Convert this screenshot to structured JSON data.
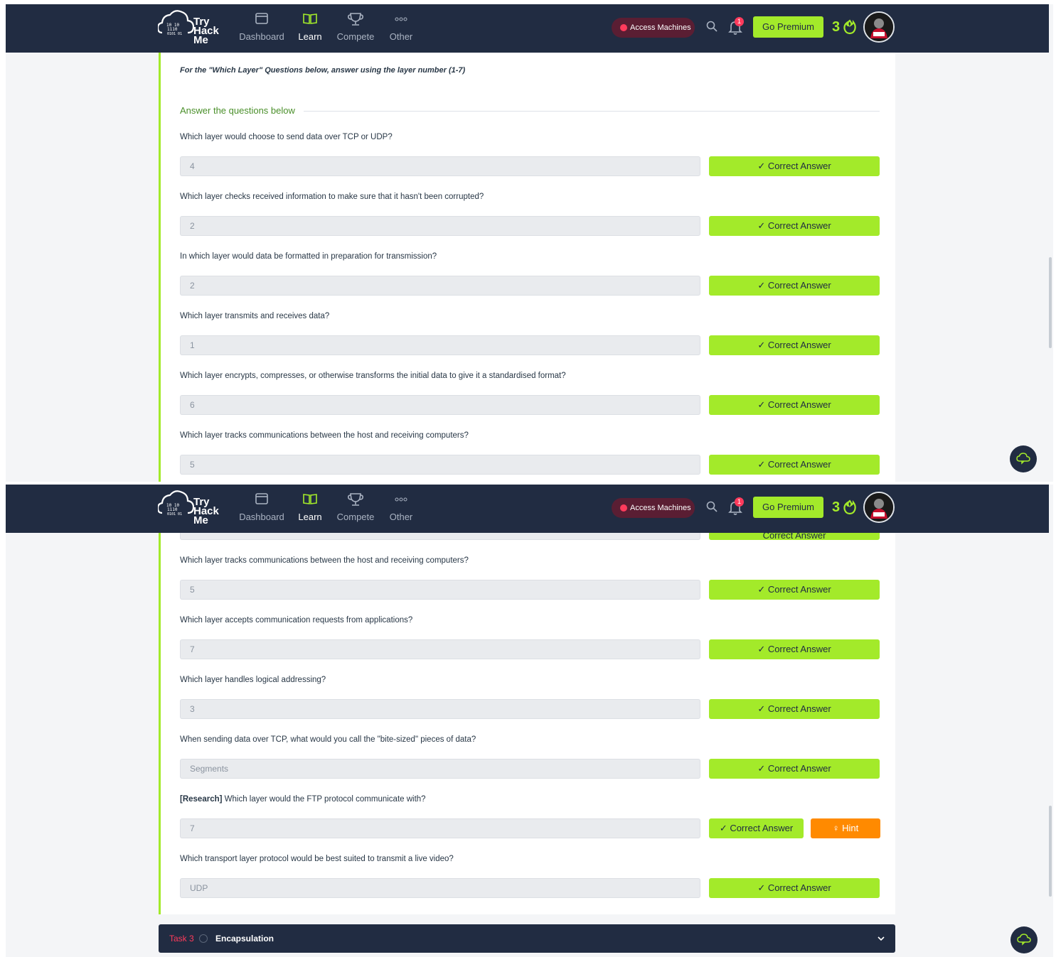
{
  "brand": {
    "line1": "Try",
    "line2": "Hack",
    "line3": "Me"
  },
  "nav": {
    "items": [
      {
        "label": "Dashboard",
        "icon": "window-icon"
      },
      {
        "label": "Learn",
        "icon": "book-icon",
        "active": true
      },
      {
        "label": "Compete",
        "icon": "trophy-icon"
      },
      {
        "label": "Other",
        "icon": "dots-icon"
      }
    ],
    "access_machines": "Access Machines",
    "notification_count": "1",
    "premium": "Go Premium",
    "streak": "3"
  },
  "colors": {
    "navy": "#212c42",
    "lime": "#a3ea2a",
    "orange": "#ff8a00",
    "red": "#ff3b5c"
  },
  "screenshot1": {
    "instruction": "For the \"Which Layer\" Questions below, answer using the layer number (1-7)",
    "section_heading": "Answer the questions below",
    "questions": [
      {
        "text": "Which layer would choose to send data over TCP or UDP?",
        "answer": "4",
        "button": "✓ Correct Answer"
      },
      {
        "text": "Which layer checks received information to make sure that it hasn't been corrupted?",
        "answer": "2",
        "button": "✓ Correct Answer"
      },
      {
        "text": "In which layer would data be formatted in preparation for transmission?",
        "answer": "2",
        "button": "✓ Correct Answer"
      },
      {
        "text": "Which layer transmits and receives data?",
        "answer": "1",
        "button": "✓ Correct Answer"
      },
      {
        "text": "Which layer encrypts, compresses, or otherwise transforms the initial data to give it a standardised format?",
        "answer": "6",
        "button": "✓ Correct Answer"
      },
      {
        "text": "Which layer tracks communications between the host and receiving computers?",
        "answer": "5",
        "button": "✓ Correct Answer"
      }
    ]
  },
  "screenshot2": {
    "partial_button": "Correct Answer",
    "questions": [
      {
        "text": "Which layer tracks communications between the host and receiving computers?",
        "answer": "5",
        "button": "✓ Correct Answer"
      },
      {
        "text": "Which layer accepts communication requests from applications?",
        "answer": "7",
        "button": "✓ Correct Answer"
      },
      {
        "text": "Which layer handles logical addressing?",
        "answer": "3",
        "button": "✓ Correct Answer"
      },
      {
        "text": "When sending data over TCP, what would you call the \"bite-sized\" pieces of data?",
        "answer": "Segments",
        "button": "✓ Correct Answer"
      },
      {
        "prefix": "[Research]",
        "text": " Which layer would the FTP protocol communicate with?",
        "answer": "7",
        "button": "✓ Correct Answer",
        "hint": "♀ Hint"
      },
      {
        "text": "Which transport layer protocol would be best suited to transmit a live video?",
        "answer": "UDP",
        "button": "✓ Correct Answer"
      }
    ],
    "task": {
      "number": "Task 3",
      "title": "Encapsulation"
    }
  }
}
